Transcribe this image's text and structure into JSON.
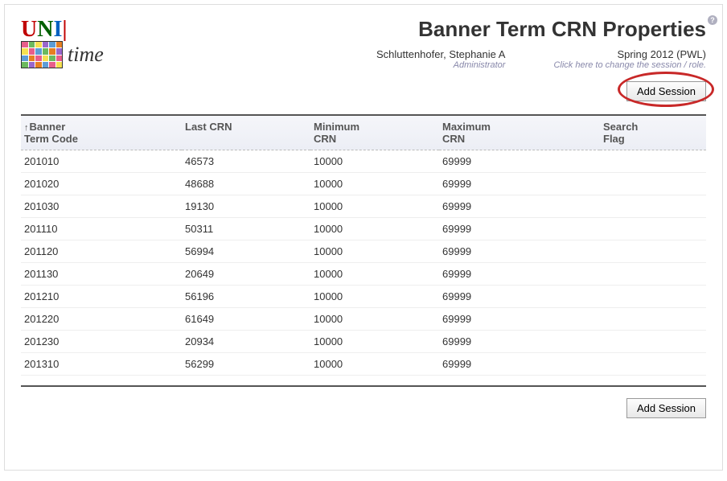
{
  "page": {
    "title": "Banner Term CRN Properties"
  },
  "logo": {
    "brand_u": "U",
    "brand_n": "N",
    "brand_i": "I",
    "brand_bar": "|",
    "brand_time": "time"
  },
  "user": {
    "name": "Schluttenhofer, Stephanie A",
    "role": "Administrator",
    "session": "Spring 2012 (PWL)",
    "session_hint": "Click here to change the session / role."
  },
  "buttons": {
    "add_session": "Add Session"
  },
  "help_icon": "?",
  "table": {
    "sort_indicator": "↑",
    "headers": {
      "term_code_line1": "Banner",
      "term_code_line2": "Term Code",
      "last_crn": "Last CRN",
      "min_crn_line1": "Minimum",
      "min_crn_line2": "CRN",
      "max_crn_line1": "Maximum",
      "max_crn_line2": "CRN",
      "search_flag_line1": "Search",
      "search_flag_line2": "Flag"
    },
    "rows": [
      {
        "term": "201010",
        "last": "46573",
        "min": "10000",
        "max": "69999",
        "flag": ""
      },
      {
        "term": "201020",
        "last": "48688",
        "min": "10000",
        "max": "69999",
        "flag": ""
      },
      {
        "term": "201030",
        "last": "19130",
        "min": "10000",
        "max": "69999",
        "flag": ""
      },
      {
        "term": "201110",
        "last": "50311",
        "min": "10000",
        "max": "69999",
        "flag": ""
      },
      {
        "term": "201120",
        "last": "56994",
        "min": "10000",
        "max": "69999",
        "flag": ""
      },
      {
        "term": "201130",
        "last": "20649",
        "min": "10000",
        "max": "69999",
        "flag": ""
      },
      {
        "term": "201210",
        "last": "56196",
        "min": "10000",
        "max": "69999",
        "flag": ""
      },
      {
        "term": "201220",
        "last": "61649",
        "min": "10000",
        "max": "69999",
        "flag": ""
      },
      {
        "term": "201230",
        "last": "20934",
        "min": "10000",
        "max": "69999",
        "flag": ""
      },
      {
        "term": "201310",
        "last": "56299",
        "min": "10000",
        "max": "69999",
        "flag": ""
      }
    ]
  }
}
